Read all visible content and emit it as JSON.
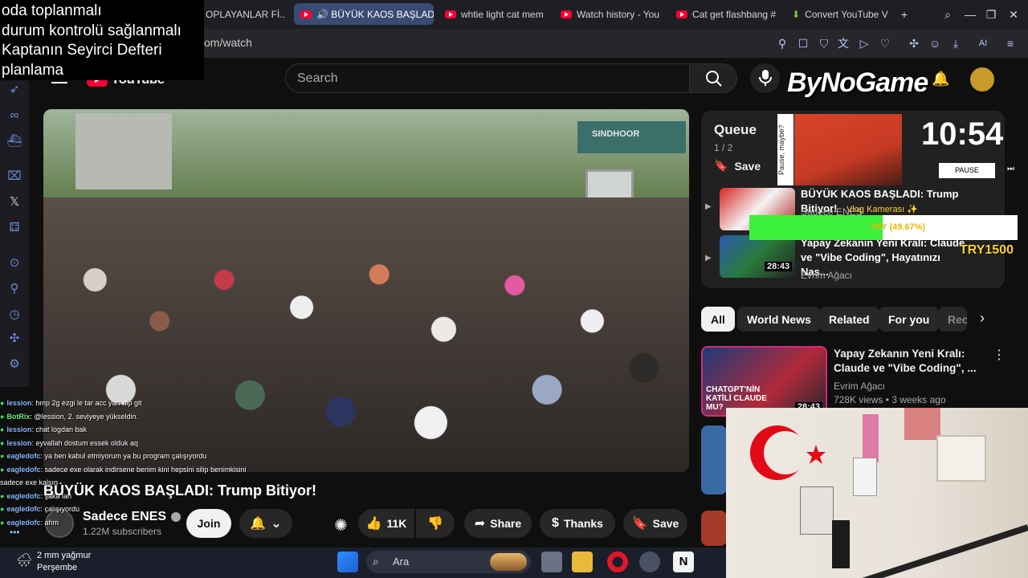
{
  "notes": [
    "oda toplanmalı",
    "durum kontrolü sağlanmalı",
    "Kaptanın Seyirci Defteri",
    "planlama"
  ],
  "tabs": [
    {
      "label": "OPLAYANLAR Fİ..."
    },
    {
      "label": "BÜYÜK KAOS BAŞLAD",
      "active": true
    },
    {
      "label": "whtie light cat mem"
    },
    {
      "label": "Watch history - You"
    },
    {
      "label": "Cat get flashbang #"
    },
    {
      "label": "Convert YouTube V"
    }
  ],
  "address": {
    "url": "om/watch"
  },
  "youtube": {
    "search_placeholder": "Search",
    "logo_text": "YouTube",
    "video": {
      "station_sign": "SINDHOOR",
      "title": "BÜYÜK KAOS BAŞLADI: Trump Bitiyor!",
      "channel": "Sadece ENES",
      "subscribers": "1.22M subscribers",
      "join_label": "Join",
      "like_count": "11K",
      "share_label": "Share",
      "thanks_label": "Thanks",
      "save_label": "Save"
    },
    "queue": {
      "title": "Queue",
      "count": "1 / 2",
      "save_label": "Save",
      "items": [
        {
          "title": "BÜYÜK KAOS BAŞLADI: Trump Bitiyor!",
          "channel": "Sadece ENES"
        },
        {
          "title": "Yapay Zekanın Yeni Kralı: Claude ve \"Vibe Coding\", Hayatınızı Nas...",
          "channel": "Evrim Ağacı",
          "duration": "28:43"
        }
      ]
    },
    "chips": [
      "All",
      "World News",
      "Related",
      "For you",
      "Rec"
    ],
    "recommendation": {
      "title": "Yapay Zekanın Yeni Kralı: Claude ve \"Vibe Coding\", ...",
      "channel": "Evrim Ağacı",
      "meta": "728K views • 3 weeks ago",
      "duration": "28:43",
      "thumb_text": "CHATGPT'NİN KATİLİ CLAUDE MU?"
    }
  },
  "overlay": {
    "brand": "ByNoGame",
    "clock": "10:54",
    "pause_label": "PAUSE",
    "art_side_text": "Pause, maybe?",
    "vlog_label": "Vlog Kamerası ✨",
    "progress_fraction": 0.4967,
    "progress_text": "TRY (49.67%)",
    "try_label": "TRY1500"
  },
  "chat": [
    {
      "nick": "lession",
      "msg": ": hmp 2g ezgi le tar acc yarı alp git"
    },
    {
      "nick": "BotRix",
      "msg": ": @lession, 2. seviyeye yükseldin."
    },
    {
      "nick": "lession",
      "msg": ": chat logdan bak"
    },
    {
      "nick": "lession",
      "msg": ": eyvallah dostum essek olduk aq"
    },
    {
      "nick": "eagledofc",
      "msg": ": ya ben kabul etmiyorum ya bu program çalışıyordu"
    },
    {
      "nick": "eagledofc",
      "msg": ": sadece exe olarak indirsene benim kini hepsini silip benimkisini sadece exe kalsın"
    },
    {
      "nick": "eagledofc",
      "msg": ": şaka lan"
    },
    {
      "nick": "eagledofc",
      "msg": ": çalışıyordu"
    },
    {
      "nick": "eagledofc",
      "msg": ": ahm"
    }
  ],
  "taskbar": {
    "weather_temp": "2 mm yağmur",
    "weather_day": "Perşembe",
    "search_label": "Ara"
  },
  "colors": {
    "accent": "#ff0033",
    "progress": "#3cf03c",
    "brand_yellow": "#ffd23a"
  }
}
